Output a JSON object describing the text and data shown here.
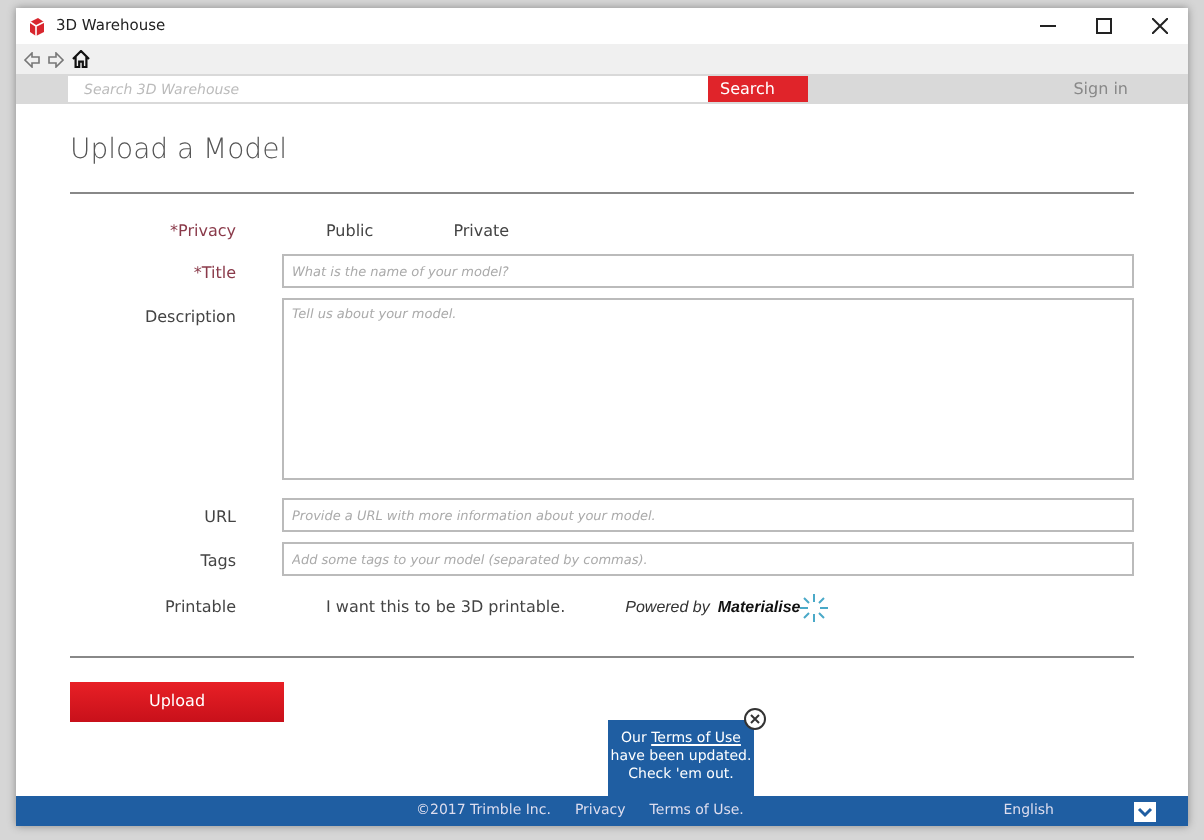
{
  "window": {
    "title": "3D Warehouse"
  },
  "search": {
    "placeholder": "Search 3D Warehouse",
    "button": "Search",
    "sign_in": "Sign in"
  },
  "page_title": "Upload a Model",
  "form": {
    "privacy": {
      "label": "*Privacy",
      "required": true,
      "options": [
        "Public",
        "Private"
      ]
    },
    "fields": [
      {
        "label": "*Title",
        "required": true,
        "kind": "input",
        "placeholder": "What is the name of your model?"
      },
      {
        "label": "Description",
        "required": false,
        "kind": "textarea",
        "placeholder": "Tell us about your model."
      },
      {
        "label": "URL",
        "required": false,
        "kind": "input",
        "placeholder": "Provide a URL with more information about your model."
      },
      {
        "label": "Tags",
        "required": false,
        "kind": "input",
        "placeholder": "Add some tags to your model (separated by commas)."
      }
    ],
    "printable": {
      "label": "Printable",
      "text": "I want this to be 3D printable.",
      "powered_by": "Powered by",
      "brand": "Materialise"
    },
    "submit": "Upload"
  },
  "notice": {
    "before": "Our",
    "link": "Terms of Use",
    "after": "have been updated. Check 'em out."
  },
  "footer": {
    "copyright": "©2017 Trimble Inc.",
    "links": [
      "Privacy",
      "Terms of Use."
    ],
    "language": "English"
  }
}
